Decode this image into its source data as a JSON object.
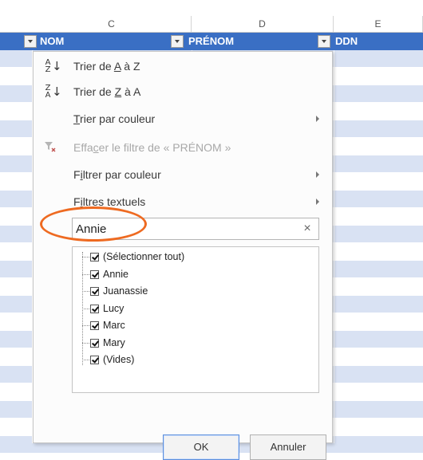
{
  "columns": {
    "c": "C",
    "d": "D",
    "e": "E"
  },
  "header": {
    "nom": "NOM",
    "prenom": "PRÉNOM",
    "ddn": "DDN"
  },
  "menu": {
    "sort_asc": {
      "pre": "Trier de ",
      "a": "A",
      "mid": " à Z"
    },
    "sort_desc": {
      "pre": "Trier de ",
      "z": "Z",
      "mid": " à A"
    },
    "sort_color": {
      "u": "T",
      "rest": "rier par couleur"
    },
    "clear_filter": {
      "pre": "Effa",
      "u": "c",
      "rest": "er le filtre de « PRÉNOM »"
    },
    "filter_color": {
      "pre": "F",
      "u": "i",
      "rest": "ltrer par couleur"
    },
    "text_filters": {
      "pre": "F",
      "u": "i",
      "rest": "ltres textuels"
    }
  },
  "icons": {
    "sort_asc": "A Z",
    "sort_desc": "Z A"
  },
  "search": {
    "value": "Annie",
    "clear": "×"
  },
  "list": {
    "items": [
      "(Sélectionner tout)",
      "Annie",
      "Juanassie",
      "Lucy",
      "Marc",
      "Mary",
      "(Vides)"
    ]
  },
  "buttons": {
    "ok": "OK",
    "cancel": "Annuler"
  },
  "colors": {
    "header_bg": "#3a6fc4",
    "band": "#d9e2f3",
    "highlight": "#ee6a21"
  }
}
